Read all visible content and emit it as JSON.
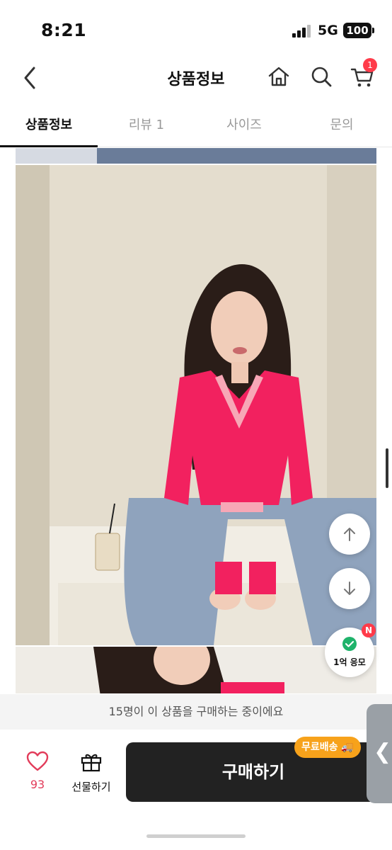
{
  "status_bar": {
    "time": "8:21",
    "network": "5G",
    "battery": "100"
  },
  "header": {
    "title": "상품정보",
    "cart_count": "1"
  },
  "tabs": [
    {
      "label": "상품정보",
      "active": true
    },
    {
      "label": "리뷰 1",
      "active": false
    },
    {
      "label": "사이즈",
      "active": false
    },
    {
      "label": "문의",
      "active": false
    }
  ],
  "icons": {
    "back": "chevron-left-icon",
    "home": "home-icon",
    "search": "search-icon",
    "cart": "cart-icon",
    "scroll_up": "arrow-up-icon",
    "scroll_down": "arrow-down-icon",
    "event": "check-badge-icon",
    "like": "heart-icon",
    "gift": "gift-icon",
    "handle": "chevron-left-icon"
  },
  "floating": {
    "event_label": "1억 응모",
    "event_badge": "N"
  },
  "notice": "15명이 이 상품을 구매하는 중이에요",
  "bottom": {
    "like_count": "93",
    "gift_label": "선물하기",
    "buy_label": "구매하기",
    "free_shipping": "무료배송"
  },
  "colors": {
    "accent": "#ff3b4a",
    "buy_button": "#222222",
    "free_shipping": "#f7a21b",
    "like": "#e23c5a"
  }
}
